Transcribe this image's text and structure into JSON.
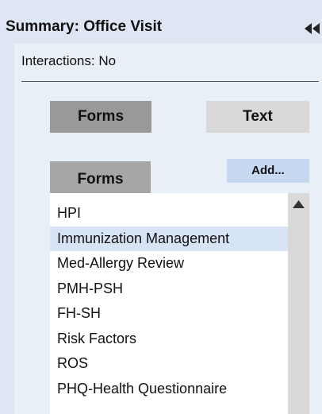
{
  "header": {
    "title": "Summary:  Office Visit",
    "collapse_icon": "double-chevron-left-icon"
  },
  "summary": {
    "interactions_text": "Interactions: No"
  },
  "toggles": {
    "forms_label": "Forms",
    "text_label": "Text",
    "selected": "Forms"
  },
  "forms_panel": {
    "tab_label": "Forms",
    "add_label": "Add...",
    "items": [
      {
        "label": "HPI",
        "selected": false
      },
      {
        "label": "Immunization Management",
        "selected": true
      },
      {
        "label": "Med-Allergy Review",
        "selected": false
      },
      {
        "label": "PMH-PSH",
        "selected": false
      },
      {
        "label": "FH-SH",
        "selected": false
      },
      {
        "label": "Risk Factors",
        "selected": false
      },
      {
        "label": "ROS",
        "selected": false
      },
      {
        "label": "PHQ-Health Questionnaire",
        "selected": false
      }
    ],
    "scroll_icon": "triangle-up-icon"
  },
  "colors": {
    "panel_bg": "#dde6f2",
    "content_bg": "#e9eff7",
    "selected_row": "#d6e4f5",
    "add_button_bg": "#c5d9f1",
    "forms_toggle_active": "#999999",
    "text_toggle_inactive": "#d9d9d9",
    "scrollbar": "#d9d9d9"
  }
}
